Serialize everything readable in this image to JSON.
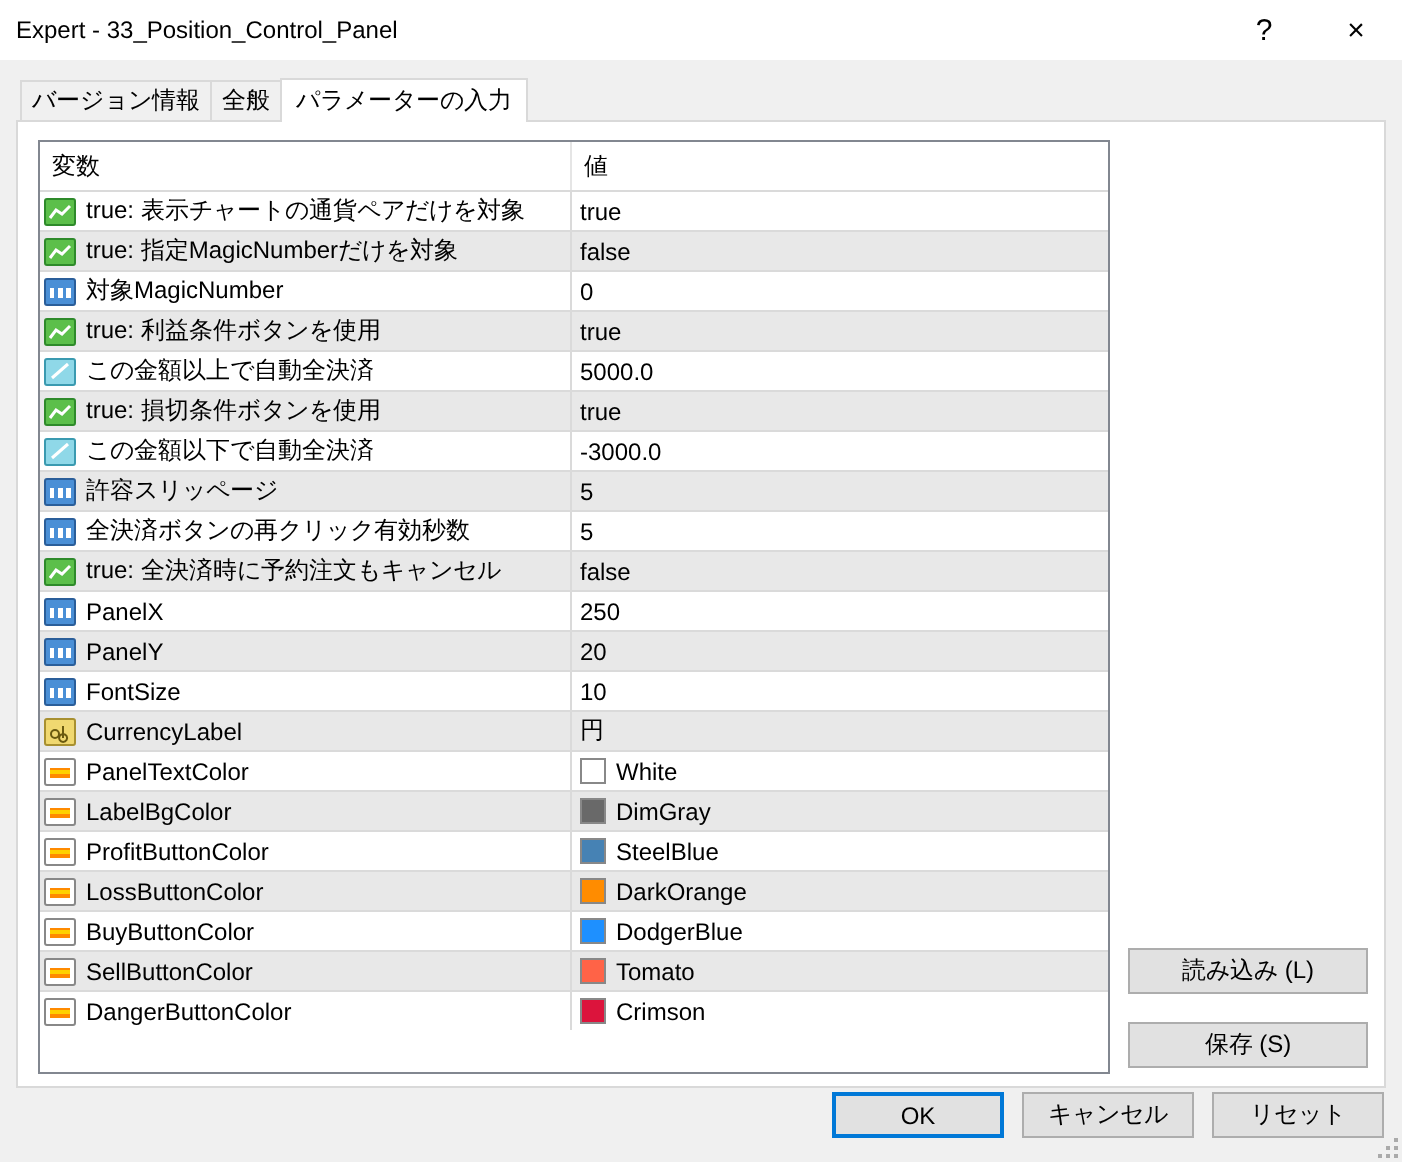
{
  "window": {
    "title": "Expert - 33_Position_Control_Panel",
    "help": "?",
    "close": "×"
  },
  "tabs": [
    {
      "label": "バージョン情報",
      "selected": false
    },
    {
      "label": "全般",
      "selected": false
    },
    {
      "label": "パラメーターの入力",
      "selected": true
    }
  ],
  "table": {
    "columns": [
      "変数",
      "値"
    ],
    "rows": [
      {
        "kind": "bool",
        "name": "true: 表示チャートの通貨ペアだけを対象",
        "value": "true"
      },
      {
        "kind": "bool",
        "name": "true: 指定MagicNumberだけを対象",
        "value": "false"
      },
      {
        "kind": "int",
        "name": "対象MagicNumber",
        "value": "0"
      },
      {
        "kind": "bool",
        "name": "true: 利益条件ボタンを使用",
        "value": "true"
      },
      {
        "kind": "double",
        "name": "この金額以上で自動全決済",
        "value": "5000.0"
      },
      {
        "kind": "bool",
        "name": "true: 損切条件ボタンを使用",
        "value": "true"
      },
      {
        "kind": "double",
        "name": "この金額以下で自動全決済",
        "value": "-3000.0"
      },
      {
        "kind": "int",
        "name": "許容スリッページ",
        "value": "5"
      },
      {
        "kind": "int",
        "name": "全決済ボタンの再クリック有効秒数",
        "value": "5"
      },
      {
        "kind": "bool",
        "name": "true: 全決済時に予約注文もキャンセル",
        "value": "false"
      },
      {
        "kind": "int",
        "name": "PanelX",
        "value": "250"
      },
      {
        "kind": "int",
        "name": "PanelY",
        "value": "20"
      },
      {
        "kind": "int",
        "name": "FontSize",
        "value": "10"
      },
      {
        "kind": "string",
        "name": "CurrencyLabel",
        "value": "円"
      },
      {
        "kind": "color",
        "name": "PanelTextColor",
        "value": "White",
        "color": "#ffffff"
      },
      {
        "kind": "color",
        "name": "LabelBgColor",
        "value": "DimGray",
        "color": "#696969"
      },
      {
        "kind": "color",
        "name": "ProfitButtonColor",
        "value": "SteelBlue",
        "color": "#4682b4"
      },
      {
        "kind": "color",
        "name": "LossButtonColor",
        "value": "DarkOrange",
        "color": "#ff8c00"
      },
      {
        "kind": "color",
        "name": "BuyButtonColor",
        "value": "DodgerBlue",
        "color": "#1e90ff"
      },
      {
        "kind": "color",
        "name": "SellButtonColor",
        "value": "Tomato",
        "color": "#ff6347"
      },
      {
        "kind": "color",
        "name": "DangerButtonColor",
        "value": "Crimson",
        "color": "#dc143c"
      }
    ]
  },
  "side_buttons": [
    "読み込み (L)",
    "保存 (S)"
  ],
  "buttons": [
    {
      "label": "OK",
      "default": true
    },
    {
      "label": "キャンセル",
      "default": false
    },
    {
      "label": "リセット",
      "default": false
    }
  ]
}
